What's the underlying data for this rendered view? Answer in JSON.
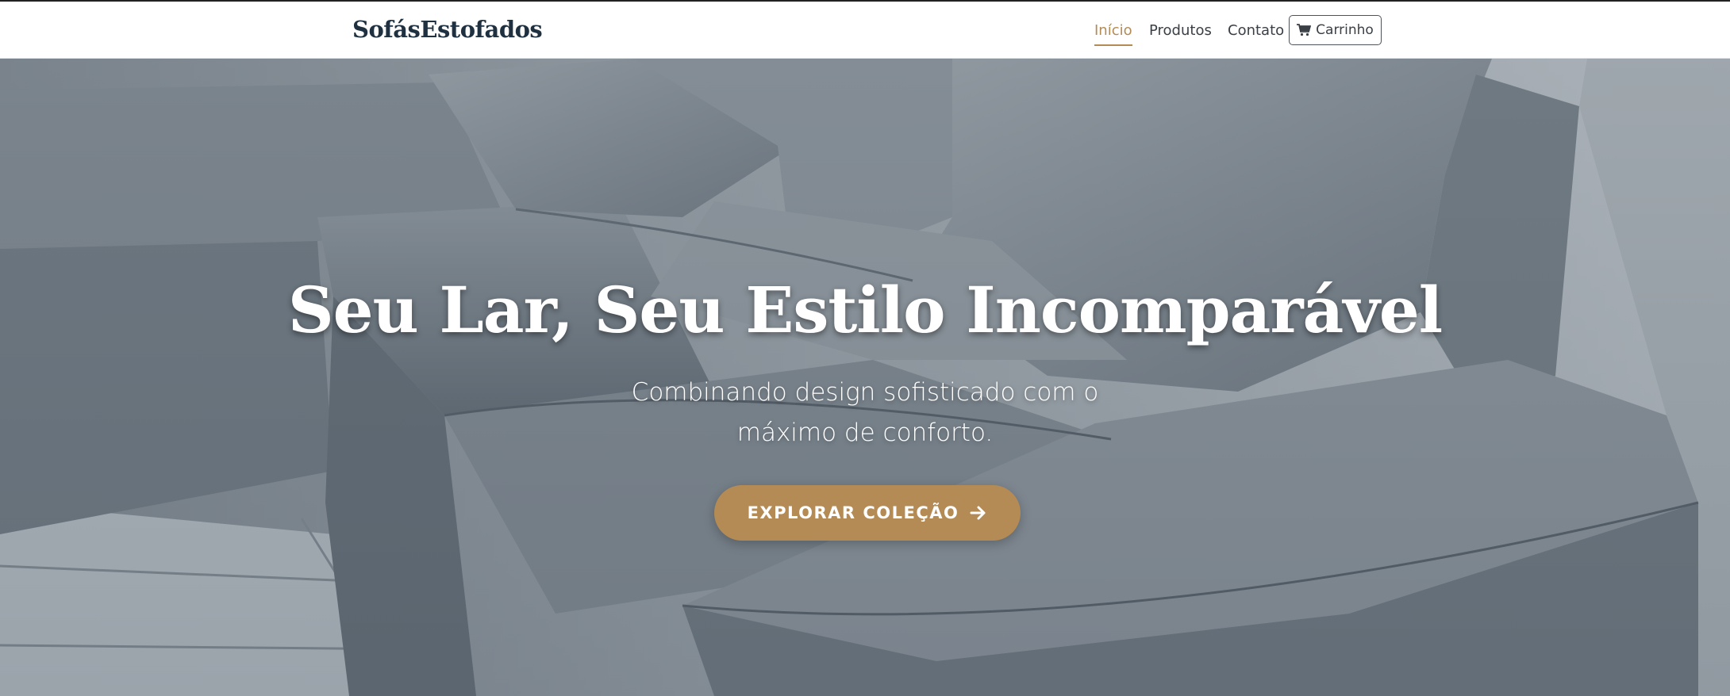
{
  "navbar": {
    "brand": "SofásEstofados",
    "links": [
      {
        "label": "Início",
        "active": true
      },
      {
        "label": "Produtos",
        "active": false
      },
      {
        "label": "Contato",
        "active": false
      }
    ],
    "cart": {
      "label": "Carrinho",
      "icon": "shopping-cart-icon"
    }
  },
  "hero": {
    "title": "Seu Lar, Seu Estilo Incomparável",
    "subtitle": "Combinando design sofisticado com o máximo de conforto.",
    "cta_label": "EXPLORAR COLEÇÃO",
    "cta_icon": "arrow-right-icon",
    "background": "gray fabric sectional sofa photo"
  },
  "colors": {
    "accent": "#b48b55",
    "brand_text": "#1f3140",
    "nav_text": "#3a3f45",
    "hero_text": "#ffffff"
  }
}
